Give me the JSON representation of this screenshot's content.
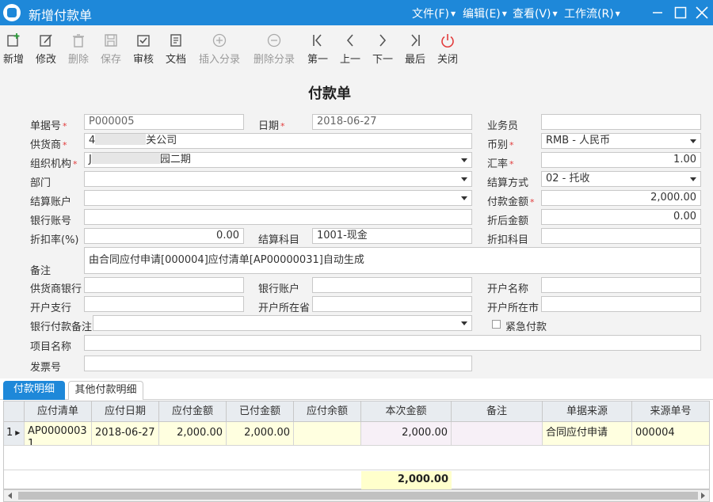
{
  "window": {
    "title": "新增付款单",
    "menus": [
      "文件(F)",
      "编辑(E)",
      "查看(V)",
      "工作流(R)"
    ]
  },
  "toolbar": [
    {
      "label": "新增",
      "icon": "new-icon",
      "enabled": true
    },
    {
      "label": "修改",
      "icon": "edit-icon",
      "enabled": true
    },
    {
      "label": "删除",
      "icon": "trash-icon",
      "enabled": false
    },
    {
      "label": "保存",
      "icon": "save-icon",
      "enabled": false
    },
    {
      "label": "审核",
      "icon": "audit-icon",
      "enabled": true
    },
    {
      "label": "文档",
      "icon": "document-icon",
      "enabled": true
    },
    {
      "label": "插入分录",
      "icon": "insert-row-icon",
      "enabled": false
    },
    {
      "label": "删除分录",
      "icon": "delete-row-icon",
      "enabled": false
    },
    {
      "label": "第一",
      "icon": "first-icon",
      "enabled": true
    },
    {
      "label": "上一",
      "icon": "prev-icon",
      "enabled": true
    },
    {
      "label": "下一",
      "icon": "next-icon",
      "enabled": true
    },
    {
      "label": "最后",
      "icon": "last-icon",
      "enabled": true
    },
    {
      "label": "关闭",
      "icon": "power-icon",
      "enabled": true
    }
  ],
  "form": {
    "title": "付款单",
    "labels": {
      "doc_no": "单据号",
      "date": "日期",
      "salesman": "业务员",
      "supplier": "供货商",
      "currency": "币别",
      "org": "组织机构",
      "rate": "汇率",
      "dept": "部门",
      "settle_method": "结算方式",
      "settle_account": "结算账户",
      "pay_amount": "付款金额",
      "bank_account_no": "银行账号",
      "after_discount": "折后金额",
      "discount_rate": "折扣率(%)",
      "settle_subject": "结算科目",
      "discount_subject": "折扣科目",
      "remark": "备注",
      "supplier_bank": "供货商银行",
      "bank_account": "银行账户",
      "account_name": "开户名称",
      "branch": "开户支行",
      "province": "开户所在省",
      "city": "开户所在市",
      "bank_pay_remark": "银行付款备注",
      "urgent": "紧急付款",
      "project": "项目名称",
      "invoice": "发票号"
    },
    "required_mark": "*",
    "values": {
      "doc_no": "P000005",
      "date": "2018-06-27",
      "salesman": "",
      "supplier_prefix": "4",
      "supplier_suffix": "关公司",
      "currency": "RMB - 人民币",
      "org_prefix": "J",
      "org_suffix": "园二期",
      "rate": "1.00",
      "dept": "",
      "settle_method": "02 - 托收",
      "settle_account": "",
      "pay_amount": "2,000.00",
      "bank_account_no": "",
      "after_discount": "0.00",
      "discount_rate": "0.00",
      "settle_subject": "1001-现金",
      "discount_subject": "",
      "remark": "由合同应付申请[000004]应付清单[AP00000031]自动生成",
      "supplier_bank": "",
      "bank_account": "",
      "account_name": "",
      "branch": "",
      "province": "",
      "city": "",
      "bank_pay_remark": "",
      "urgent": false,
      "project": "",
      "invoice": ""
    }
  },
  "tabs": [
    "付款明细",
    "其他付款明细"
  ],
  "grid": {
    "columns": [
      "应付清单",
      "应付日期",
      "应付金额",
      "已付金额",
      "应付余额",
      "本次金额",
      "备注",
      "单据来源",
      "来源单号"
    ],
    "rows": [
      {
        "index": "1",
        "cells": [
          "AP00000031",
          "2018-06-27",
          "2,000.00",
          "2,000.00",
          "",
          "2,000.00",
          "",
          "合同应付申请",
          "000004"
        ]
      }
    ],
    "total": "2,000.00"
  },
  "colors": {
    "accent": "#1e88d9",
    "required": "#e23b3b",
    "yellow_cell": "#ffffe0",
    "total_cell": "#ffffcc"
  }
}
